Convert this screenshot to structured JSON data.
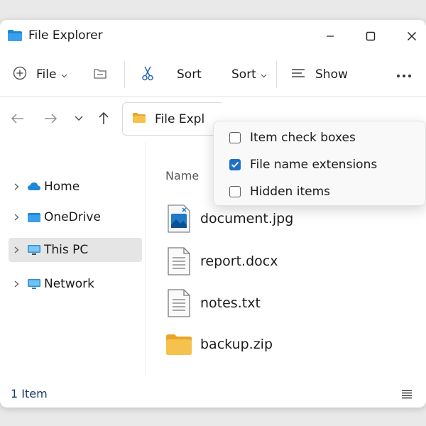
{
  "window": {
    "title": "File Explorer"
  },
  "toolbar": {
    "new_label": "File",
    "sort_label_1": "Sort",
    "sort_label_2": "Sort",
    "view_label": "Show"
  },
  "address": {
    "text": "File Expl"
  },
  "sidebar": {
    "items": [
      {
        "label": "Home",
        "icon": "cloud-icon"
      },
      {
        "label": "OneDrive",
        "icon": "onedrive-folder-icon"
      },
      {
        "label": "This PC",
        "icon": "monitor-icon",
        "selected": true
      },
      {
        "label": "Network",
        "icon": "network-monitor-icon"
      }
    ]
  },
  "list": {
    "column_header": "Name",
    "files": [
      {
        "name": "document.jpg",
        "icon": "image-file-icon"
      },
      {
        "name": "report.docx",
        "icon": "document-file-icon"
      },
      {
        "name": "notes.txt",
        "icon": "text-file-icon"
      },
      {
        "name": "backup.zip",
        "icon": "folder-icon"
      }
    ]
  },
  "menu": {
    "items": [
      {
        "label": "Item check boxes",
        "checked": false
      },
      {
        "label": "File name extensions",
        "checked": true
      },
      {
        "label": "Hidden items",
        "checked": false
      }
    ]
  },
  "status": {
    "text": "1 Item"
  },
  "colors": {
    "accent": "#1f6fc6",
    "folder": "#f3b73e"
  }
}
